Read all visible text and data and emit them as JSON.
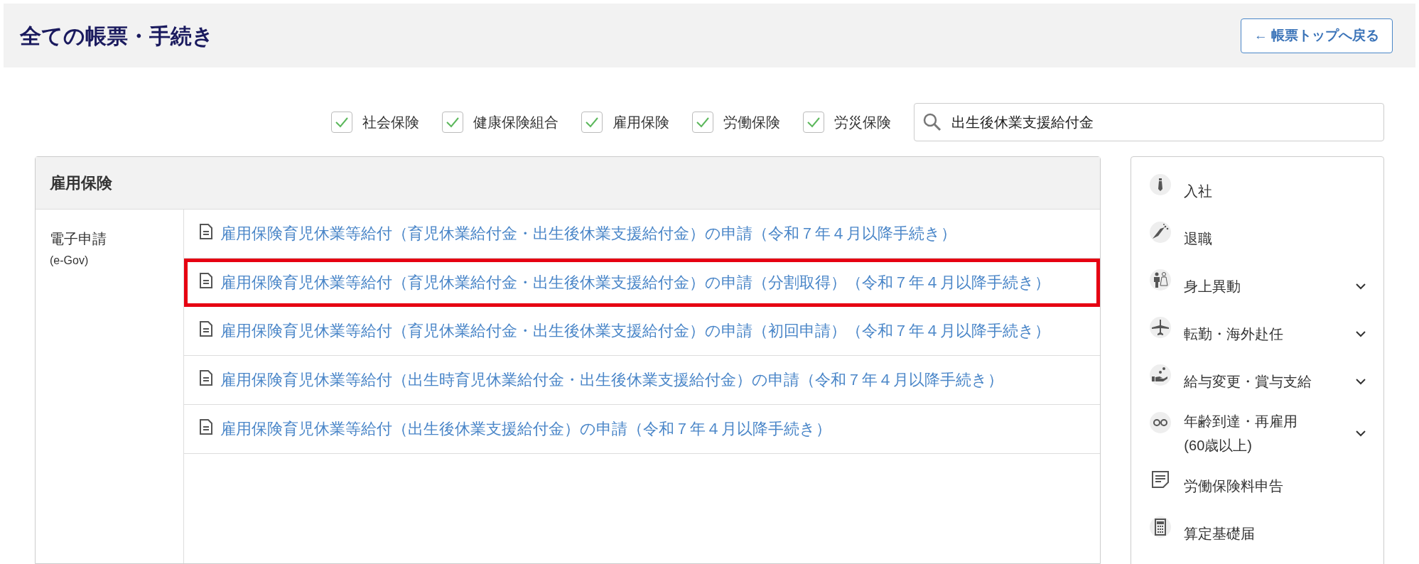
{
  "header": {
    "title": "全ての帳票・手続き",
    "back_button": "← 帳票トップへ戻る"
  },
  "filters": [
    {
      "label": "社会保険",
      "checked": true
    },
    {
      "label": "健康保険組合",
      "checked": true
    },
    {
      "label": "雇用保険",
      "checked": true
    },
    {
      "label": "労働保険",
      "checked": true
    },
    {
      "label": "労災保険",
      "checked": true
    }
  ],
  "search": {
    "value": "出生後休業支援給付金"
  },
  "section": {
    "title": "雇用保険",
    "category": "電子申請",
    "category_sub": "(e-Gov)",
    "rows": [
      {
        "label": "雇用保険育児休業等給付（育児休業給付金・出生後休業支援給付金）の申請（令和７年４月以降手続き）",
        "highlighted": false
      },
      {
        "label": "雇用保険育児休業等給付（育児休業給付金・出生後休業支援給付金）の申請（分割取得）（令和７年４月以降手続き）",
        "highlighted": true
      },
      {
        "label": "雇用保険育児休業等給付（育児休業給付金・出生後休業支援給付金）の申請（初回申請）（令和７年４月以降手続き）",
        "highlighted": false
      },
      {
        "label": "雇用保険育児休業等給付（出生時育児休業給付金・出生後休業支援給付金）の申請（令和７年４月以降手続き）",
        "highlighted": false
      },
      {
        "label": "雇用保険育児休業等給付（出生後休業支援給付金）の申請（令和７年４月以降手続き）",
        "highlighted": false
      }
    ]
  },
  "sidebar": {
    "items": [
      {
        "kind": "tie",
        "label": "入社",
        "expandable": false
      },
      {
        "kind": "bouquet",
        "label": "退職",
        "expandable": false
      },
      {
        "kind": "couple",
        "label": "身上異動",
        "expandable": true
      },
      {
        "kind": "plane",
        "label": "転勤・海外赴任",
        "expandable": true
      },
      {
        "kind": "hand",
        "label": "給与変更・賞与支給",
        "expandable": true
      },
      {
        "kind": "glasses",
        "label": "年齢到達・再雇用\n(60歳以上)",
        "expandable": true
      },
      {
        "kind": "form",
        "label": "労働保険料申告",
        "expandable": false
      },
      {
        "kind": "calculator",
        "label": "算定基礎届",
        "expandable": false
      }
    ]
  }
}
